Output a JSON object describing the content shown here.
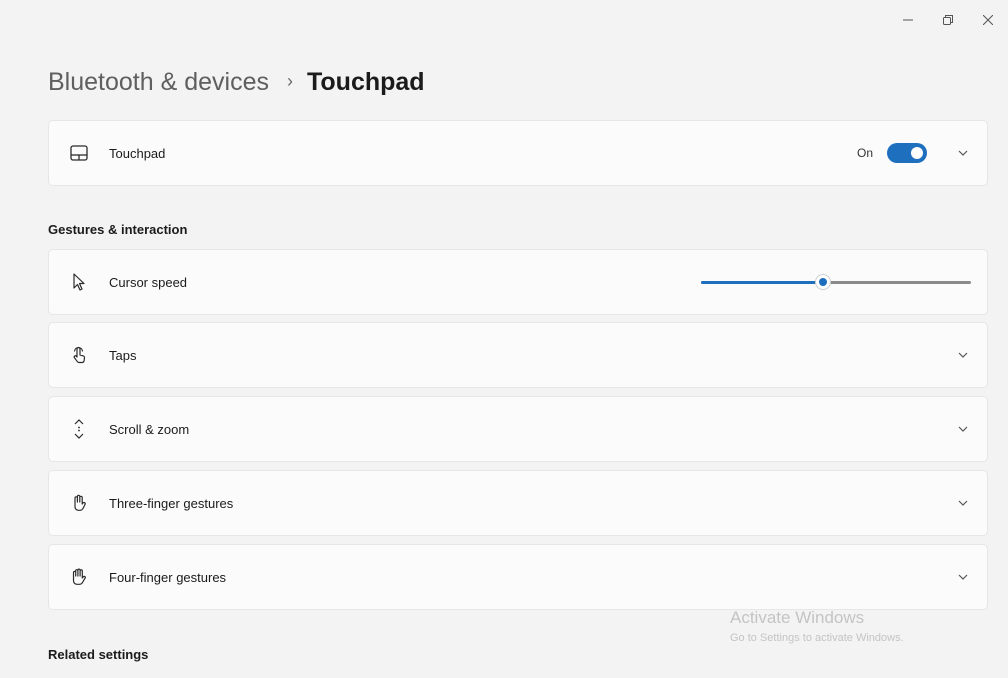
{
  "window": {
    "minimize_icon": "minimize-icon",
    "restore_icon": "restore-icon",
    "close_icon": "close-icon"
  },
  "breadcrumb": {
    "parent": "Bluetooth & devices",
    "separator": "›",
    "current": "Touchpad"
  },
  "touchpad_card": {
    "label": "Touchpad",
    "icon": "touchpad-icon",
    "toggle_state": "On",
    "toggle_on": true
  },
  "gestures_section": {
    "title": "Gestures & interaction",
    "items": [
      {
        "label": "Cursor speed",
        "icon": "cursor-icon"
      },
      {
        "label": "Taps",
        "icon": "tap-icon"
      },
      {
        "label": "Scroll & zoom",
        "icon": "scroll-icon"
      },
      {
        "label": "Three-finger gestures",
        "icon": "hand-icon"
      },
      {
        "label": "Four-finger gestures",
        "icon": "hand-icon"
      }
    ],
    "cursor_speed_value": 0.45
  },
  "related_settings": {
    "title": "Related settings"
  },
  "watermark": {
    "title": "Activate Windows",
    "subtitle": "Go to Settings to activate Windows."
  },
  "colors": {
    "accent": "#1f6fbf",
    "background": "#f3f3f3",
    "card": "#fbfbfb"
  }
}
